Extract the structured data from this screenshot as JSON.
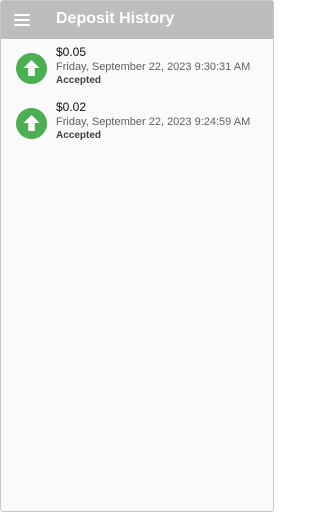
{
  "header": {
    "title": "Deposit History",
    "menu_icon": "hamburger-menu-icon",
    "background": "#bdbdbd"
  },
  "deposits": [
    {
      "amount": "$0.05",
      "date": "Friday, September 22, 2023 9:30:31 AM",
      "status": "Accepted",
      "icon": "arrow-up-icon",
      "icon_color": "#4caf50"
    },
    {
      "amount": "$0.02",
      "date": "Friday, September 22, 2023 9:24:59 AM",
      "status": "Accepted",
      "icon": "arrow-up-icon",
      "icon_color": "#4caf50"
    }
  ]
}
